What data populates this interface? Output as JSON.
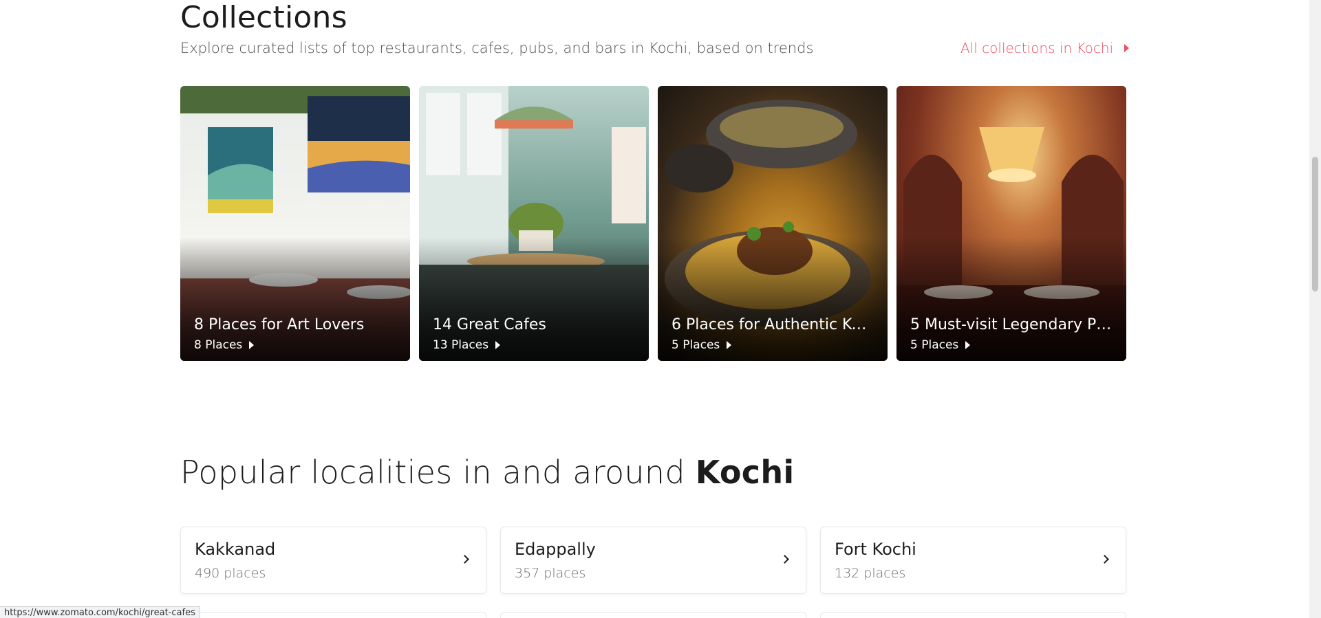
{
  "collections": {
    "title": "Collections",
    "subtitle": "Explore curated lists of top restaurants, cafes, pubs, and bars in Kochi, based on trends",
    "all_link": "All collections in Kochi",
    "cards": [
      {
        "title": "8 Places for Art Lovers",
        "count": "8 Places"
      },
      {
        "title": "14 Great Cafes",
        "count": "13 Places"
      },
      {
        "title": "6 Places for Authentic Ku...",
        "count": "5 Places"
      },
      {
        "title": "5 Must-visit Legendary Pl...",
        "count": "5 Places"
      }
    ]
  },
  "localities": {
    "title_prefix": "Popular localities in and around ",
    "title_city": "Kochi",
    "items": [
      {
        "name": "Kakkanad",
        "count": "490 places"
      },
      {
        "name": "Edappally",
        "count": "357 places"
      },
      {
        "name": "Fort Kochi",
        "count": "132 places"
      }
    ]
  },
  "status_bar": {
    "url": "https://www.zomato.com/kochi/great-cafes"
  },
  "colors": {
    "accent": "#ef4f5f",
    "text": "#1c1c1c",
    "muted": "#696969"
  },
  "icons": {
    "link_caret": "caret-right-icon",
    "card_caret": "caret-right-icon",
    "locality_chevron": "chevron-right-icon"
  }
}
